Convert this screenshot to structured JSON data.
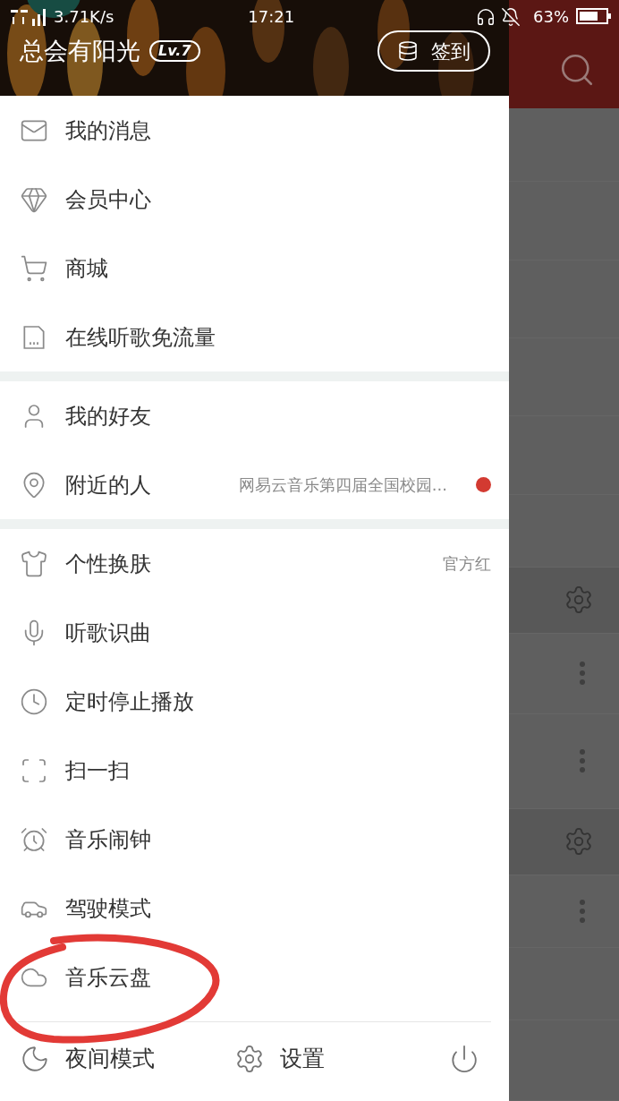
{
  "status_bar": {
    "speed": "3.71K/s",
    "time": "17:21",
    "battery": "63%"
  },
  "profile": {
    "name": "总会有阳光",
    "level": "Lv.7",
    "checkin": "签到"
  },
  "sections": [
    {
      "items": [
        {
          "label": "我的消息"
        },
        {
          "label": "会员中心"
        },
        {
          "label": "商城"
        },
        {
          "label": "在线听歌免流量"
        }
      ]
    },
    {
      "items": [
        {
          "label": "我的好友"
        },
        {
          "label": "附近的人",
          "detail": "网易云音乐第四届全国校园...",
          "unread": true
        }
      ]
    },
    {
      "items": [
        {
          "label": "个性换肤",
          "detail": "官方红"
        },
        {
          "label": "听歌识曲"
        },
        {
          "label": "定时停止播放"
        },
        {
          "label": "扫一扫"
        },
        {
          "label": "音乐闹钟"
        },
        {
          "label": "驾驶模式"
        },
        {
          "label": "音乐云盘"
        }
      ]
    }
  ],
  "bottom_bar": [
    {
      "kind": "labeled",
      "label": "夜间模式"
    },
    {
      "kind": "labeled",
      "label": "设置"
    },
    {
      "kind": "icon_only"
    }
  ]
}
